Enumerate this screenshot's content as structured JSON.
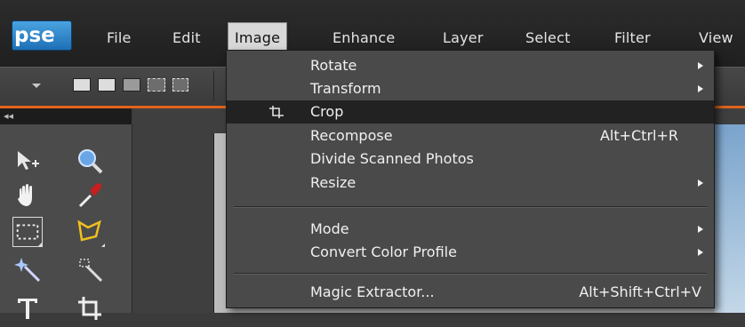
{
  "app": {
    "logo_text": "pse"
  },
  "menubar": {
    "items": [
      {
        "label": "File"
      },
      {
        "label": "Edit"
      },
      {
        "label": "Image",
        "active": true
      },
      {
        "label": "Enhance"
      },
      {
        "label": "Layer"
      },
      {
        "label": "Select"
      },
      {
        "label": "Filter"
      },
      {
        "label": "View"
      }
    ]
  },
  "panel": {
    "collapse_glyph": "◂◂"
  },
  "image_menu": {
    "items": [
      {
        "label": "Rotate",
        "submenu": true
      },
      {
        "label": "Transform",
        "submenu": true
      },
      {
        "label": "Crop",
        "icon": "crop-icon",
        "highlighted": true
      },
      {
        "label": "Recompose",
        "shortcut": "Alt+Ctrl+R"
      },
      {
        "label": "Divide Scanned Photos"
      },
      {
        "label": "Resize",
        "submenu": true
      },
      {
        "label": "Mode",
        "submenu": true
      },
      {
        "label": "Convert Color Profile",
        "submenu": true
      },
      {
        "label": "Magic Extractor...",
        "shortcut": "Alt+Shift+Ctrl+V"
      }
    ]
  },
  "colors": {
    "accent_orange": "#e0641c",
    "logo_blue": "#1d6fb5",
    "menu_bg": "#4a4a4a",
    "highlight_bg": "#222222"
  }
}
